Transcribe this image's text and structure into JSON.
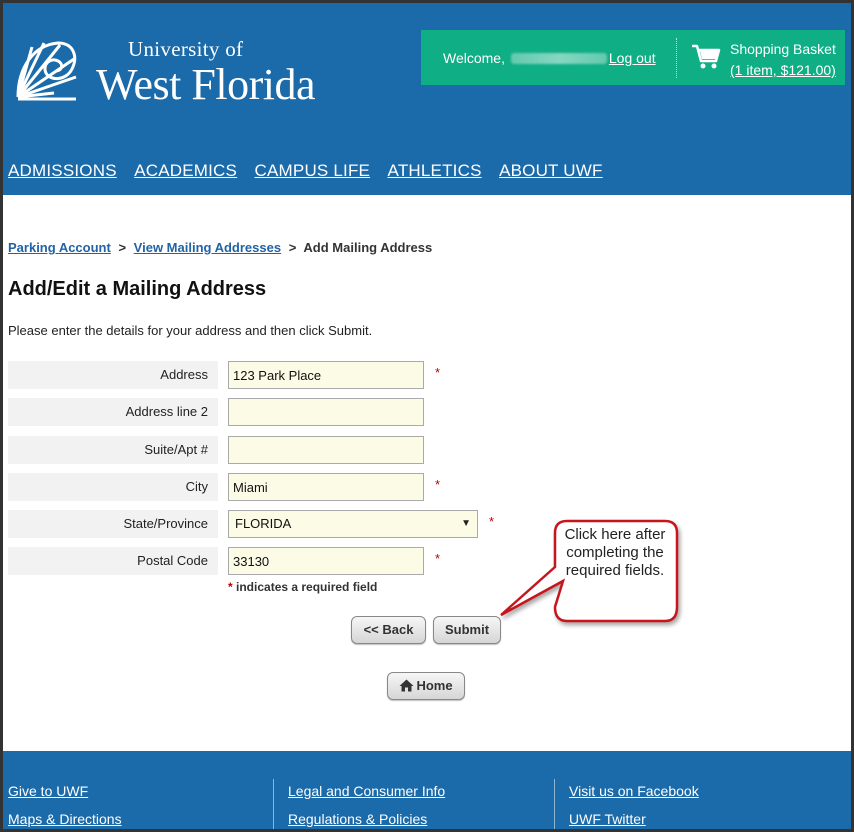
{
  "header": {
    "logo_small": "University of",
    "logo_big": "West Florida",
    "welcome_label": "Welcome,",
    "logout_label": "Log out",
    "basket_title": "Shopping Basket",
    "basket_summary": "(1 item, $121.00)",
    "cart_icon": "shopping-cart-icon"
  },
  "nav": [
    "ADMISSIONS",
    "ACADEMICS",
    "CAMPUS LIFE",
    "ATHLETICS",
    "ABOUT UWF"
  ],
  "breadcrumb": {
    "item1": "Parking Account",
    "item2": "View Mailing Addresses",
    "current": "Add Mailing Address",
    "separator": ">"
  },
  "page": {
    "title": "Add/Edit a Mailing Address",
    "instructions": "Please enter the details for your address and then click Submit."
  },
  "form": {
    "address": {
      "label": "Address",
      "value": "123 Park Place"
    },
    "address2": {
      "label": "Address line 2",
      "value": ""
    },
    "suite": {
      "label": "Suite/Apt #",
      "value": ""
    },
    "city": {
      "label": "City",
      "value": "Miami"
    },
    "state": {
      "label": "State/Province",
      "value": "FLORIDA"
    },
    "postal": {
      "label": "Postal Code",
      "value": "33130"
    },
    "required_star": "*",
    "required_note": "indicates a required field"
  },
  "buttons": {
    "back": "<< Back",
    "submit": "Submit",
    "home": "Home"
  },
  "callout": {
    "text": "Click here after completing the required fields."
  },
  "footer": {
    "col1": [
      "Give to UWF",
      "Maps & Directions"
    ],
    "col2": [
      "Legal and Consumer Info",
      "Regulations & Policies"
    ],
    "col3": [
      "Visit us on Facebook",
      "UWF Twitter"
    ]
  },
  "colors": {
    "brand_blue": "#1b6aa9",
    "welcome_green": "#0fae84",
    "input_bg": "#fbfbe6",
    "required_red": "#b00000",
    "callout_border": "#c4141b"
  }
}
